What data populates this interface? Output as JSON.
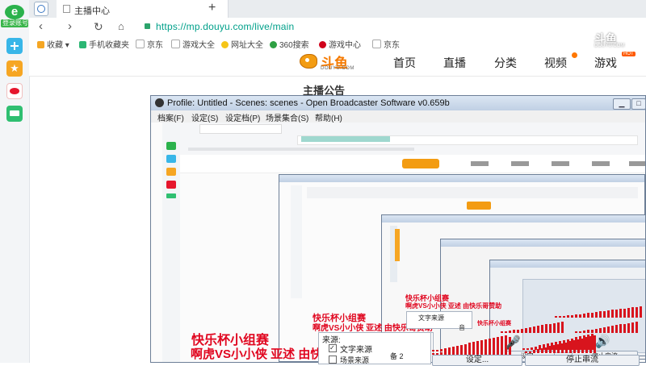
{
  "browser": {
    "login_label": "登录账号",
    "tab_title": "主播中心",
    "new_tab": "+",
    "url": "https://mp.douyu.com/live/main",
    "bookmarks": [
      {
        "label": "收藏",
        "color": "#f5a623"
      },
      {
        "label": "手机收藏夹",
        "color": "#2bb673"
      },
      {
        "label": "京东",
        "color": "#c0c0c0"
      },
      {
        "label": "游戏大全",
        "color": "#c0c0c0"
      },
      {
        "label": "网址大全",
        "color": "#f5c518"
      },
      {
        "label": "360搜索",
        "color": "#2ea043"
      },
      {
        "label": "游戏中心",
        "color": "#d0021b"
      },
      {
        "label": "京东",
        "color": "#c0c0c0"
      }
    ]
  },
  "site": {
    "logo_text": "斗鱼",
    "logo_sub": "DOUYU.COM",
    "nav": [
      "首页",
      "直播",
      "分类",
      "视频",
      "游戏"
    ],
    "hot_badge": "HOT",
    "announcement": "主播公告",
    "watermark_text": "斗鱼",
    "watermark_sub": "DOUYU.COM"
  },
  "obs": {
    "title": "Profile: Untitled - Scenes: scenes - Open Broadcaster Software v0.659b",
    "menu": [
      "档案(F)",
      "设定(S)",
      "设定档(P)",
      "场景集合(S)",
      "帮助(H)"
    ],
    "overlay_line1": "快乐杯小组赛",
    "overlay_line2": "啊虎VS小小侠  亚述  由快乐哥赞助",
    "sources_label": "来源:",
    "source_text": "文字来源",
    "source_other": "备 2",
    "source_third": "场景来源",
    "settings_button": "设定...",
    "stop_button": "停止串流",
    "mic_label": "麦",
    "vol_label": "音"
  }
}
